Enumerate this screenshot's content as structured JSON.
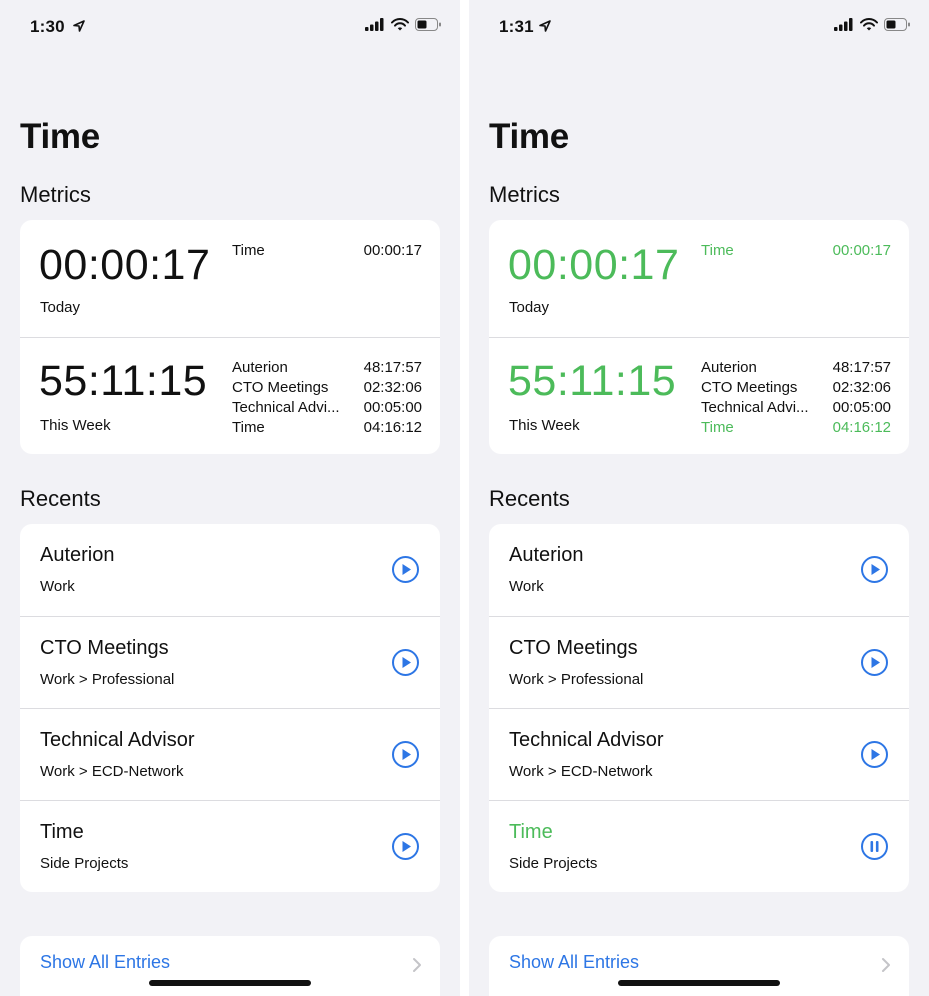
{
  "colors": {
    "accent": "#2d76e5",
    "active": "#4cbb5a",
    "background": "#f2f2f6"
  },
  "left": {
    "status_time": "1:30",
    "title": "Time",
    "metrics_header": "Metrics",
    "today": {
      "total": "00:00:17",
      "label": "Today",
      "items": [
        {
          "name": "Time",
          "duration": "00:00:17"
        }
      ]
    },
    "week": {
      "total": "55:11:15",
      "label": "This Week",
      "items": [
        {
          "name": "Auterion",
          "duration": "48:17:57"
        },
        {
          "name": "CTO Meetings",
          "duration": "02:32:06"
        },
        {
          "name": "Technical Advi...",
          "duration": "00:05:00"
        },
        {
          "name": "Time",
          "duration": "04:16:12"
        }
      ]
    },
    "recents_header": "Recents",
    "recents": [
      {
        "name": "Auterion",
        "category": "Work",
        "icon": "play-icon"
      },
      {
        "name": "CTO Meetings",
        "category": "Work > Professional",
        "icon": "play-icon"
      },
      {
        "name": "Technical Advisor",
        "category": "Work > ECD-Network",
        "icon": "play-icon"
      },
      {
        "name": "Time",
        "category": "Side Projects",
        "icon": "play-icon"
      }
    ],
    "show_all": "Show All Entries"
  },
  "right": {
    "status_time": "1:31",
    "title": "Time",
    "metrics_header": "Metrics",
    "today": {
      "total": "00:00:17",
      "label": "Today",
      "items": [
        {
          "name": "Time",
          "duration": "00:00:17"
        }
      ]
    },
    "week": {
      "total": "55:11:15",
      "label": "This Week",
      "items": [
        {
          "name": "Auterion",
          "duration": "48:17:57"
        },
        {
          "name": "CTO Meetings",
          "duration": "02:32:06"
        },
        {
          "name": "Technical Advi...",
          "duration": "00:05:00"
        },
        {
          "name": "Time",
          "duration": "04:16:12"
        }
      ]
    },
    "recents_header": "Recents",
    "recents": [
      {
        "name": "Auterion",
        "category": "Work",
        "icon": "play-icon"
      },
      {
        "name": "CTO Meetings",
        "category": "Work > Professional",
        "icon": "play-icon"
      },
      {
        "name": "Technical Advisor",
        "category": "Work > ECD-Network",
        "icon": "play-icon"
      },
      {
        "name": "Time",
        "category": "Side Projects",
        "icon": "pause-icon",
        "running": true
      }
    ],
    "show_all": "Show All Entries"
  }
}
